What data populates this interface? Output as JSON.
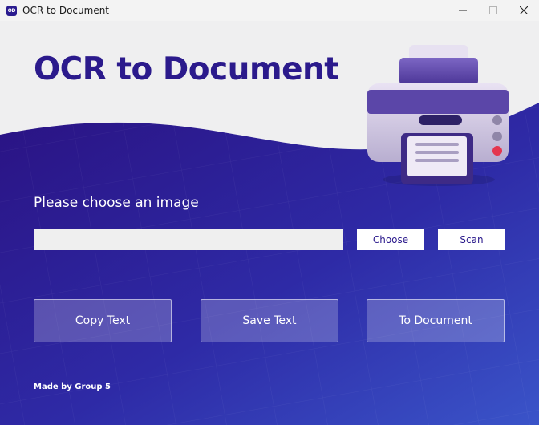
{
  "window": {
    "title": "OCR to Document",
    "icon_label": "OD",
    "controls": [
      "minimize-icon",
      "maximize-icon",
      "close-icon"
    ]
  },
  "main": {
    "heading": "OCR to Document",
    "prompt": "Please choose an image",
    "path_input": {
      "value": "",
      "placeholder": ""
    },
    "choose_label": "Choose",
    "scan_label": "Scan",
    "actions": {
      "copy_label": "Copy Text",
      "save_label": "Save Text",
      "document_label": "To Document"
    },
    "footer": "Made by Group 5",
    "illustration": "printer-icon"
  },
  "colors": {
    "brand": "#2b1a8c",
    "background_light": "#efeff0",
    "background_gradient_start": "#2a1282",
    "background_gradient_end": "#3a54c9"
  }
}
